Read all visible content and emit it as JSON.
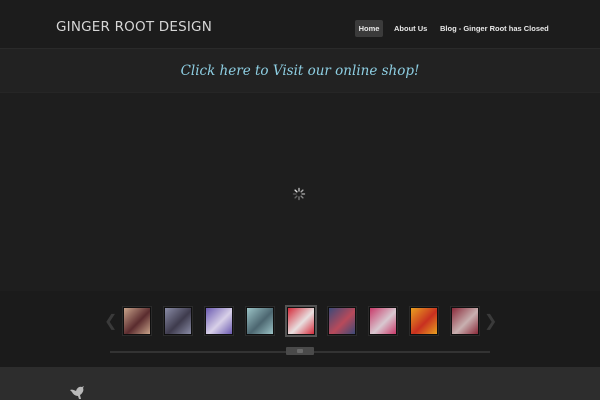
{
  "header": {
    "site_title": "GINGER ROOT DESIGN",
    "nav": [
      {
        "label": "Home",
        "active": true
      },
      {
        "label": "About Us",
        "active": false
      },
      {
        "label": "Blog - Ginger Root has Closed",
        "active": false
      }
    ]
  },
  "shop_banner": {
    "link_text": "Click here to Visit our online shop!",
    "link_color": "#8ecfe3"
  },
  "slideshow": {
    "loading_icon": "spinner-icon",
    "thumbnails": [
      {
        "colors": [
          "#c8a38a",
          "#5a2b2e"
        ],
        "active": false
      },
      {
        "colors": [
          "#8a8ca6",
          "#3e3b4d"
        ],
        "active": false
      },
      {
        "colors": [
          "#6b5ab0",
          "#d8d0e8"
        ],
        "active": false
      },
      {
        "colors": [
          "#9bc3c6",
          "#4c6670"
        ],
        "active": false
      },
      {
        "colors": [
          "#d42a3a",
          "#e8e0e0"
        ],
        "active": true
      },
      {
        "colors": [
          "#3c4a78",
          "#b84a5a"
        ],
        "active": false
      },
      {
        "colors": [
          "#c83a6a",
          "#d8c8d0"
        ],
        "active": false
      },
      {
        "colors": [
          "#e8a020",
          "#c83020"
        ],
        "active": false
      },
      {
        "colors": [
          "#8a2a3a",
          "#c8b0b0"
        ],
        "active": false
      }
    ],
    "prev_icon": "chevron-left-icon",
    "next_icon": "chevron-right-icon"
  },
  "footer": {
    "logo_icon": "bird-icon"
  },
  "colors": {
    "background": "#1f1f1f",
    "header": "#1c1c1c",
    "footer": "#2d2d2d",
    "nav_active": "#3b3b3b"
  }
}
